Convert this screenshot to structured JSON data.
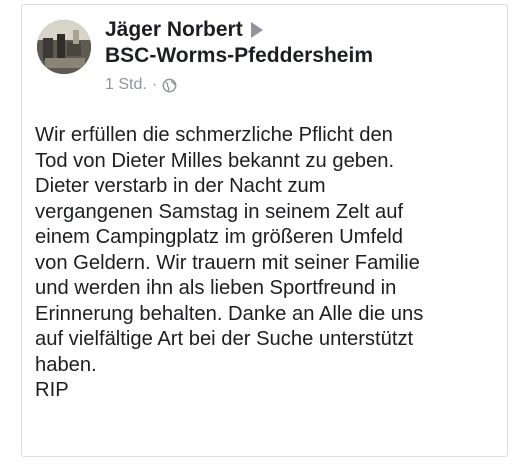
{
  "post": {
    "author": "Jäger Norbert",
    "group": "BSC-Worms-Pfeddersheim",
    "timestamp": "1 Std.",
    "separator": "·",
    "privacy_icon": "globe-icon",
    "text_lines": [
      "Wir erfüllen die schmerzliche Pflicht den",
      "Tod von Dieter Milles bekannt zu geben.",
      "Dieter verstarb in der Nacht zum",
      "vergangenen Samstag in seinem Zelt auf",
      "einem Campingplatz im größeren Umfeld",
      "von Geldern. Wir trauern mit seiner Familie",
      "und werden ihn als lieben Sportfreund in",
      "Erinnerung behalten. Danke an Alle die uns",
      "auf vielfältige Art bei der Suche unterstützt",
      "haben.",
      "RIP"
    ]
  },
  "colors": {
    "text": "#1c1e21",
    "muted": "#90949c",
    "border": "#dadde1"
  }
}
